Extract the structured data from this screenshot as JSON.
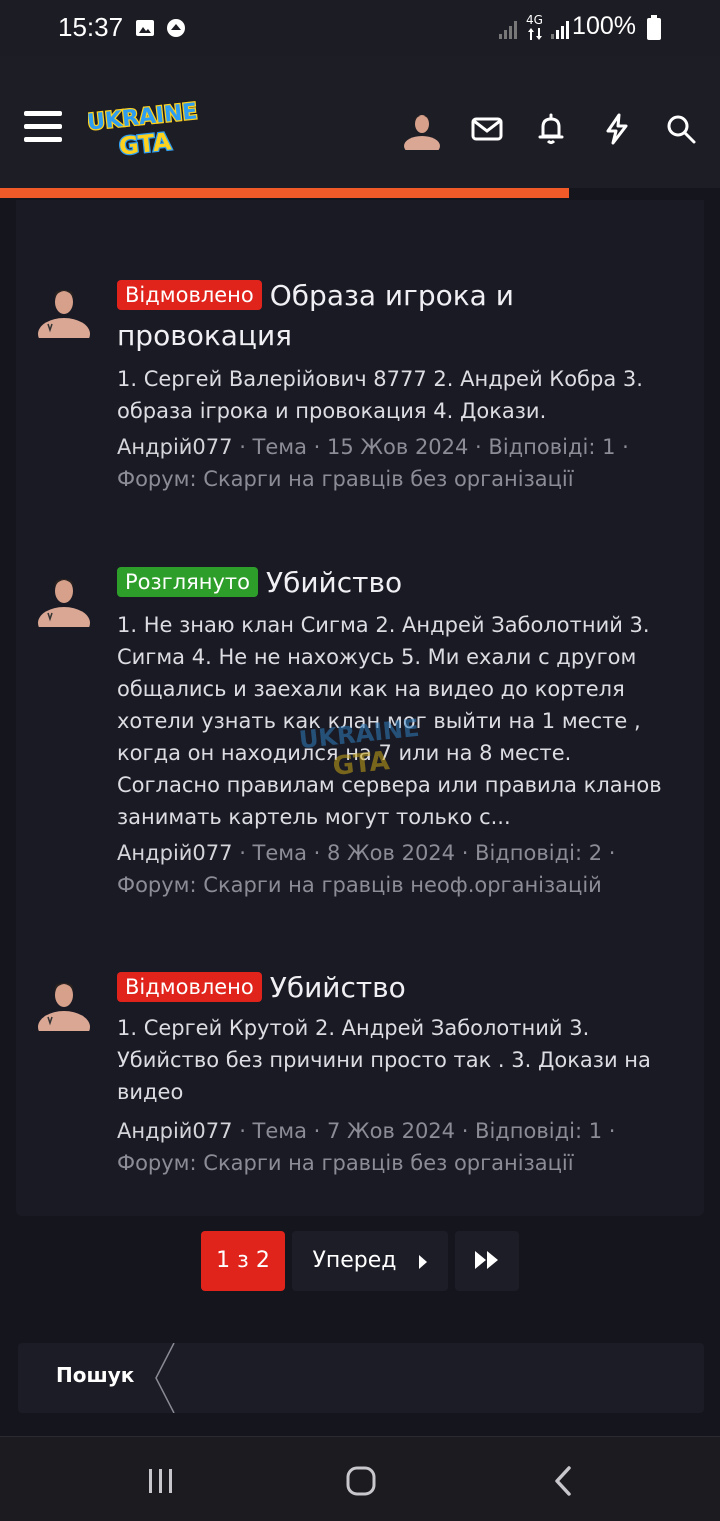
{
  "status_bar": {
    "time": "15:37",
    "network": "4G",
    "battery": "100%"
  },
  "header": {
    "logo_text_top": "UKRAINE",
    "logo_text_bottom": "GTA",
    "icons": [
      "menu-icon",
      "user-avatar",
      "mail-icon",
      "bell-icon",
      "lightning-icon",
      "search-icon"
    ],
    "progress_color": "#f05a28",
    "progress_fraction": 0.79
  },
  "results": [
    {
      "badge": "Відмовлено",
      "badge_color": "#e0241c",
      "title": "Образа игрока и провокация",
      "snippet": "1. Сергей Валерійович 8777 2. Андрей Кобра 3. образа ігрока и провокация 4. Докази.",
      "author": "Андрій077",
      "meta": " · Тема · 15 Жов 2024 · Відповіді: 1 · Форум: Скарги на гравців без організації"
    },
    {
      "badge": "Розглянуто",
      "badge_color": "#2e9e2a",
      "title": "Убийство",
      "snippet": "1. Не знаю клан Сигма 2. Андрей Заболотний 3. Сигма 4. Не не нахожусь 5. Ми ехали с другом общались и заехали как на видео до кортеля хотели узнать как клан мог выйти на 1 месте , когда он находился на 7 или на 8 месте. Согласно правилам сервера или правила кланов занимать картель могут только с...",
      "author": "Андрій077",
      "meta": " · Тема · 8 Жов 2024 · Відповіді: 2 · Форум: Скарги на гравців неоф.організацій"
    },
    {
      "badge": "Відмовлено",
      "badge_color": "#e0241c",
      "title": "Убийство",
      "snippet": "1. Сергей Крутой 2. Андрей Заболотний 3. Убийство без причини просто так . 3. Докази на видео",
      "author": "Андрій077",
      "meta": " · Тема · 7 Жов 2024 · Відповіді: 1 · Форум: Скарги на гравців без організації"
    }
  ],
  "pagination": {
    "current": "1 з 2",
    "next_label": "Уперед",
    "accent": "#e0241c"
  },
  "breadcrumb": {
    "label": "Пошук"
  }
}
